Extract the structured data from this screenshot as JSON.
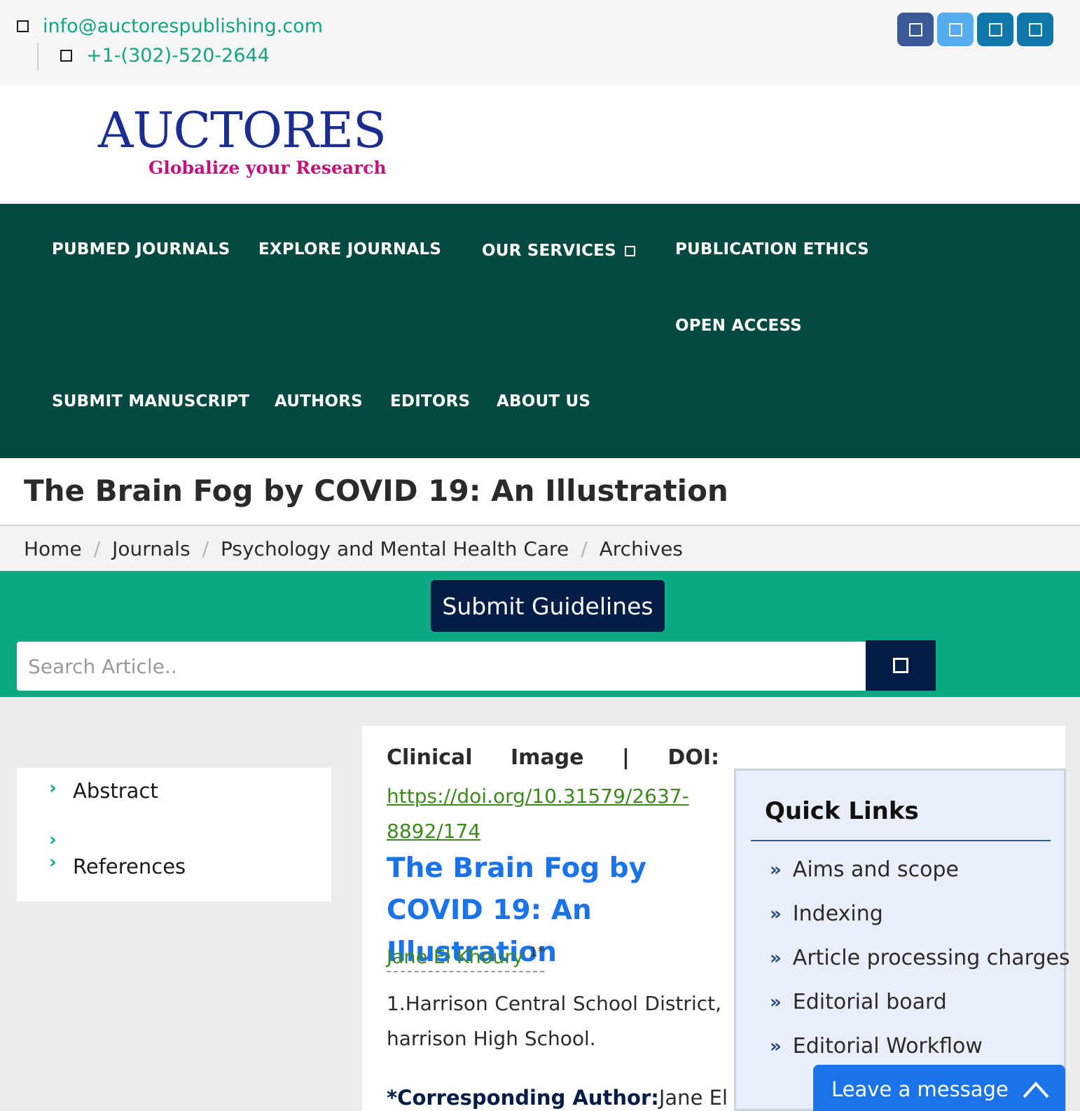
{
  "topbar": {
    "email": "info@auctorespublishing.com",
    "phone": "+1-(302)-520-2644",
    "social": [
      {
        "icon": "facebook-icon",
        "color": "#3b5998"
      },
      {
        "icon": "twitter-icon",
        "color": "#55acee"
      },
      {
        "icon": "linkedin-icon",
        "color": "#0e76a8"
      },
      {
        "icon": "share-icon",
        "color": "#0e76a8"
      }
    ]
  },
  "logo": {
    "main": "AUCTORES",
    "tagline": "Globalize your Research"
  },
  "nav": {
    "pubmed": "PUBMED JOURNALS",
    "explore": "EXPLORE JOURNALS",
    "services": "OUR SERVICES",
    "ethics": "PUBLICATION ETHICS",
    "open_access": "OPEN ACCESS",
    "submit": "SUBMIT MANUSCRIPT",
    "authors": "AUTHORS",
    "editors": "EDITORS",
    "about": "ABOUT US"
  },
  "page": {
    "title": "The Brain Fog by COVID 19: An Illustration"
  },
  "breadcrumb": [
    "Home",
    "Journals",
    "Psychology and Mental Health Care",
    "Archives"
  ],
  "submit_guidelines": "Submit Guidelines",
  "search": {
    "placeholder": "Search Article.."
  },
  "toc": {
    "abstract": "Abstract",
    "references": "References"
  },
  "article": {
    "type": "Clinical",
    "image_word": "Image",
    "pipe": "|",
    "doi_label": "DOI:",
    "doi_url": "https://doi.org/10.31579/2637-8892/174",
    "title": "The Brain Fog by COVID 19: An Illustration",
    "author": "Jane El Khoury",
    "author_sup": "1*",
    "affiliation": "1.Harrison Central School District, harrison High School.",
    "corr_label": "*Corresponding Author:",
    "corr_name": "Jane El"
  },
  "quick_links": {
    "title": "Quick Links",
    "items": [
      "Aims and scope",
      "Indexing",
      "Article processing charges",
      "Editorial board",
      "Editorial Workflow"
    ]
  },
  "chat": {
    "label": "Leave a message"
  },
  "colors": {
    "nav_bg": "#044a41",
    "accent_green": "#0aab82",
    "navy": "#031d46",
    "link_blue": "#1a73e8"
  }
}
